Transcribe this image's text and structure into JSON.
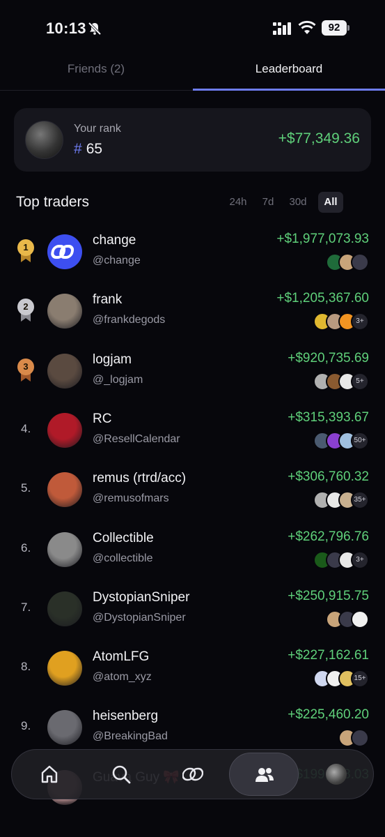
{
  "status_bar": {
    "time": "10:13",
    "battery": "92"
  },
  "tabs": [
    {
      "label": "Friends (2)",
      "active": false
    },
    {
      "label": "Leaderboard",
      "active": true
    }
  ],
  "your_rank": {
    "label": "Your rank",
    "hash": "#",
    "rank": "65",
    "pnl": "+$77,349.36"
  },
  "section": {
    "title": "Top traders"
  },
  "filters": [
    {
      "label": "24h",
      "active": false
    },
    {
      "label": "7d",
      "active": false
    },
    {
      "label": "30d",
      "active": false
    },
    {
      "label": "All",
      "active": true
    }
  ],
  "traders": [
    {
      "rank": "1",
      "medal": "gold",
      "name": "change",
      "handle": "@change",
      "pnl": "+$1,977,073.93",
      "more": "",
      "avatar_color": "#3d4ff0",
      "tokens": [
        "#1f6b3a",
        "#c8a47a",
        "#3a3a4a"
      ]
    },
    {
      "rank": "2",
      "medal": "silver",
      "name": "frank",
      "handle": "@frankdegods",
      "pnl": "+$1,205,367.60",
      "more": "3+",
      "avatar_color": "#8a7d70",
      "tokens": [
        "#e0b830",
        "#b89a80",
        "#f29422"
      ]
    },
    {
      "rank": "3",
      "medal": "bronze",
      "name": "logjam",
      "handle": "@_logjam",
      "pnl": "+$920,735.69",
      "more": "5+",
      "avatar_color": "#5a4a40",
      "tokens": [
        "#b0b0b0",
        "#8a5a30",
        "#e8e8e8"
      ]
    },
    {
      "rank": "4.",
      "medal": "",
      "name": "RC",
      "handle": "@ResellCalendar",
      "pnl": "+$315,393.67",
      "more": "50+",
      "avatar_color": "#b01a28",
      "tokens": [
        "#4a5a70",
        "#8a40d0",
        "#a0c0e0"
      ]
    },
    {
      "rank": "5.",
      "medal": "",
      "name": "remus (rtrd/acc)",
      "handle": "@remusofmars",
      "pnl": "+$306,760.32",
      "more": "35+",
      "avatar_color": "#c05a3a",
      "tokens": [
        "#b0b0b0",
        "#e8e8e8",
        "#c8b090"
      ]
    },
    {
      "rank": "6.",
      "medal": "",
      "name": "Collectible",
      "handle": "@collectible",
      "pnl": "+$262,796.76",
      "more": "3+",
      "avatar_color": "#8a8a8a",
      "tokens": [
        "#1a5a1a",
        "#3a3a4a",
        "#e8e8e8"
      ]
    },
    {
      "rank": "7.",
      "medal": "",
      "name": "DystopianSniper",
      "handle": "@DystopianSniper",
      "pnl": "+$250,915.75",
      "more": "",
      "avatar_color": "#2a3028",
      "tokens": [
        "#c8a47a",
        "#3a3a4a",
        "#f0f0f0"
      ]
    },
    {
      "rank": "8.",
      "medal": "",
      "name": "AtomLFG",
      "handle": "@atom_xyz",
      "pnl": "+$227,162.61",
      "more": "15+",
      "avatar_color": "#e0a020",
      "tokens": [
        "#d0d8f0",
        "#f0f0f0",
        "#e0c060"
      ]
    },
    {
      "rank": "9.",
      "medal": "",
      "name": "heisenberg",
      "handle": "@BreakingBad",
      "pnl": "+$225,460.20",
      "more": "",
      "avatar_color": "#6a6a70",
      "tokens": [
        "#c8a47a",
        "#3a3a4a"
      ]
    },
    {
      "rank": "",
      "medal": "",
      "name": "Guava Guy 🎀",
      "handle": "",
      "pnl": "+$199,528.03",
      "more": "",
      "avatar_color": "#d0a0a0",
      "tokens": []
    }
  ],
  "nav": [
    {
      "icon": "home-icon",
      "active": false
    },
    {
      "icon": "search-icon",
      "active": false
    },
    {
      "icon": "logo-icon",
      "active": false
    },
    {
      "icon": "friends-icon",
      "active": true
    },
    {
      "icon": "profile-icon",
      "active": false
    }
  ]
}
